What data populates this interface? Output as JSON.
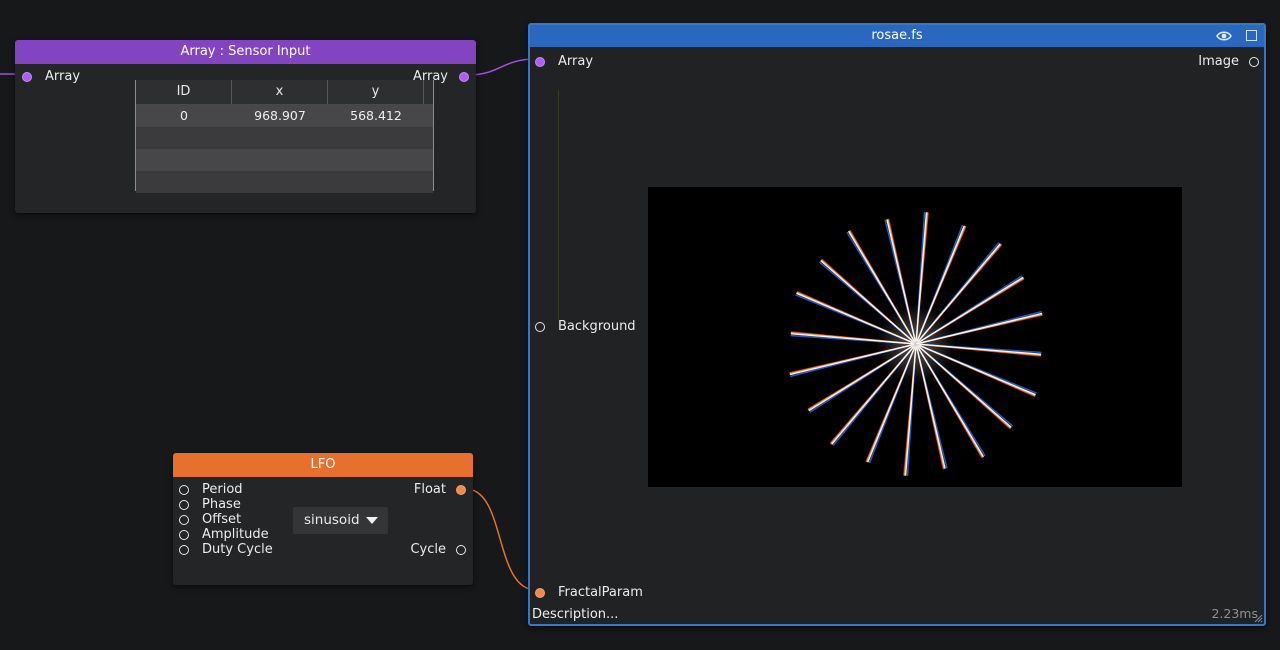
{
  "sensor_node": {
    "title": "Array : Sensor Input",
    "input_label": "Array",
    "output_label": "Array",
    "table": {
      "columns": [
        "ID",
        "x",
        "y"
      ],
      "rows": [
        [
          "0",
          "968.907",
          "568.412"
        ]
      ]
    },
    "color": "#8344c1"
  },
  "lfo_node": {
    "title": "LFO",
    "inputs": [
      "Period",
      "Phase",
      "Offset",
      "Amplitude",
      "Duty Cycle"
    ],
    "outputs": [
      "Float",
      "Cycle"
    ],
    "waveform_value": "sinusoid",
    "color": "#e8702e"
  },
  "shader_node": {
    "title": "rosae.fs",
    "inputs": [
      "Array",
      "Background",
      "FractalParam"
    ],
    "output": "Image",
    "description": "Description...",
    "timing": "2.23ms",
    "color": "#2a68c0"
  }
}
